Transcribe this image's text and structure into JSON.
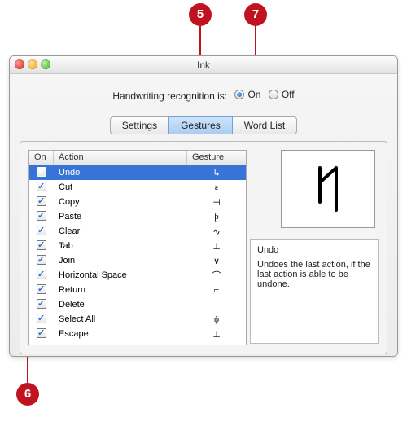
{
  "callouts": {
    "c5": "5",
    "c6": "6",
    "c7": "7"
  },
  "window": {
    "title": "Ink"
  },
  "handwriting": {
    "label": "Handwriting recognition is:",
    "on_label": "On",
    "off_label": "Off",
    "state": "on"
  },
  "tabs": {
    "settings": "Settings",
    "gestures": "Gestures",
    "wordlist": "Word List",
    "active": "gestures"
  },
  "table": {
    "headers": {
      "on": "On",
      "action": "Action",
      "gesture": "Gesture"
    },
    "rows": [
      {
        "on": true,
        "action": "Undo",
        "glyph": "↳",
        "selected": true
      },
      {
        "on": true,
        "action": "Cut",
        "glyph": "ƨ̵"
      },
      {
        "on": true,
        "action": "Copy",
        "glyph": "⊣"
      },
      {
        "on": true,
        "action": "Paste",
        "glyph": "ƥ"
      },
      {
        "on": true,
        "action": "Clear",
        "glyph": "∿"
      },
      {
        "on": true,
        "action": "Tab",
        "glyph": "⊥"
      },
      {
        "on": true,
        "action": "Join",
        "glyph": "∨"
      },
      {
        "on": true,
        "action": "Horizontal Space",
        "glyph": "⌒"
      },
      {
        "on": true,
        "action": "Return",
        "glyph": "⌐"
      },
      {
        "on": true,
        "action": "Delete",
        "glyph": "—"
      },
      {
        "on": true,
        "action": "Select All",
        "glyph": "ɸ"
      },
      {
        "on": true,
        "action": "Escape",
        "glyph": "⊥"
      }
    ]
  },
  "detail": {
    "title": "Undo",
    "body": "Undoes the last action, if the last action is able to be undone."
  }
}
